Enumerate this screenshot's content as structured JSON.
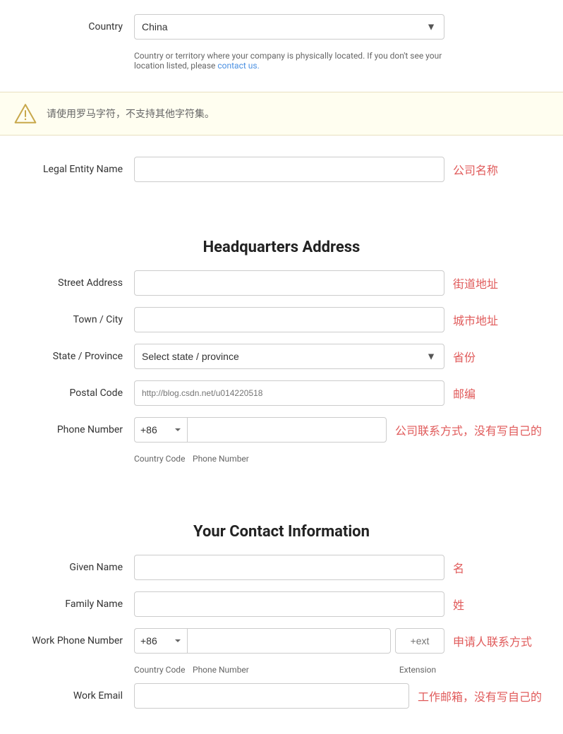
{
  "country": {
    "label": "Country",
    "value": "China",
    "helper": "Country or territory where your company is physically located. If you don't see your location listed, please",
    "link_text": "contact us.",
    "link_href": "#"
  },
  "warning": {
    "text": "请使用罗马字符，不支持其他字符集。"
  },
  "legal_entity": {
    "label": "Legal Entity Name",
    "annotation": "公司名称"
  },
  "headquarters": {
    "title": "Headquarters Address",
    "street": {
      "label": "Street Address",
      "annotation": "街道地址"
    },
    "city": {
      "label": "Town / City",
      "annotation": "城市地址"
    },
    "state": {
      "label": "State / Province",
      "placeholder": "Select state / province",
      "annotation": "省份"
    },
    "postal": {
      "label": "Postal Code",
      "placeholder": "http://blog.csdn.net/u014220518",
      "annotation": "邮编"
    },
    "phone": {
      "label": "Phone Number",
      "annotation": "公司联系方式，没有写自己的",
      "code_label": "Country Code",
      "number_label": "Phone Number"
    }
  },
  "contact": {
    "title": "Your Contact Information",
    "given_name": {
      "label": "Given Name",
      "annotation": "名"
    },
    "family_name": {
      "label": "Family Name",
      "annotation": "姓"
    },
    "work_phone": {
      "label": "Work Phone Number",
      "annotation": "申请人联系方式",
      "code_label": "Country Code",
      "number_label": "Phone Number",
      "ext_placeholder": "+ext",
      "ext_label": "Extension"
    },
    "work_email": {
      "label": "Work Email",
      "annotation": "工作邮箱，没有写自己的"
    }
  }
}
